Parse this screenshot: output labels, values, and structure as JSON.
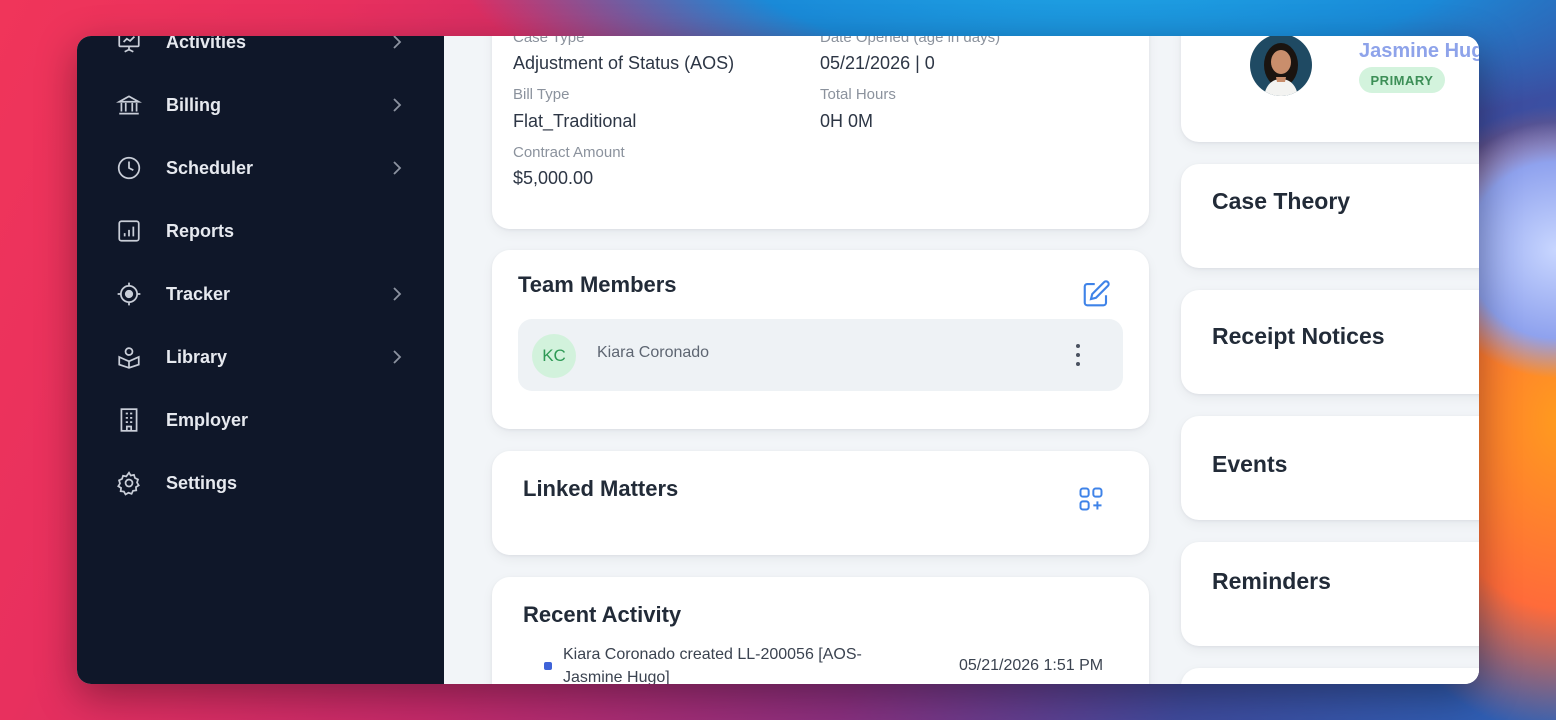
{
  "colors": {
    "sidebar_bg": "#0f1729",
    "accent_blue": "#3f83e8",
    "primary_badge_bg": "#d3f3dd",
    "primary_badge_text": "#3c8f57",
    "initials_bg": "#d2f2dc"
  },
  "sidebar": {
    "items": [
      {
        "label": "Activities",
        "icon": "presentation-icon",
        "has_chevron": true
      },
      {
        "label": "Billing",
        "icon": "bank-icon",
        "has_chevron": true
      },
      {
        "label": "Scheduler",
        "icon": "clock-icon",
        "has_chevron": true
      },
      {
        "label": "Reports",
        "icon": "report-chart-icon",
        "has_chevron": false
      },
      {
        "label": "Tracker",
        "icon": "target-icon",
        "has_chevron": true
      },
      {
        "label": "Library",
        "icon": "book-icon",
        "has_chevron": true
      },
      {
        "label": "Employer",
        "icon": "building-icon",
        "has_chevron": false
      },
      {
        "label": "Settings",
        "icon": "gear-icon",
        "has_chevron": false
      }
    ]
  },
  "case_details": {
    "case_type_label": "Case Type",
    "case_type_value": "Adjustment of Status (AOS)",
    "date_opened_label": "Date Opened (age in days)",
    "date_opened_value": "05/21/2026 | 0",
    "bill_type_label": "Bill Type",
    "bill_type_value": "Flat_Traditional",
    "total_hours_label": "Total Hours",
    "total_hours_value": "0H 0M",
    "contract_amount_label": "Contract Amount",
    "contract_amount_value": "$5,000.00"
  },
  "team_members": {
    "title": "Team Members",
    "edit_icon": "edit-icon",
    "members": [
      {
        "initials": "KC",
        "name": "Kiara Coronado"
      }
    ]
  },
  "linked_matters": {
    "title": "Linked Matters",
    "add_icon": "add-grid-icon"
  },
  "recent_activity": {
    "title": "Recent Activity",
    "items": [
      {
        "text": "Kiara Coronado created LL-200056 [AOS-Jasmine Hugo]",
        "time": "05/21/2026 1:51 PM"
      }
    ]
  },
  "client": {
    "name": "Jasmine Hugo",
    "badge": "PRIMARY"
  },
  "right_panels": [
    {
      "title": "Case Theory"
    },
    {
      "title": "Receipt Notices"
    },
    {
      "title": "Events"
    },
    {
      "title": "Reminders"
    }
  ]
}
